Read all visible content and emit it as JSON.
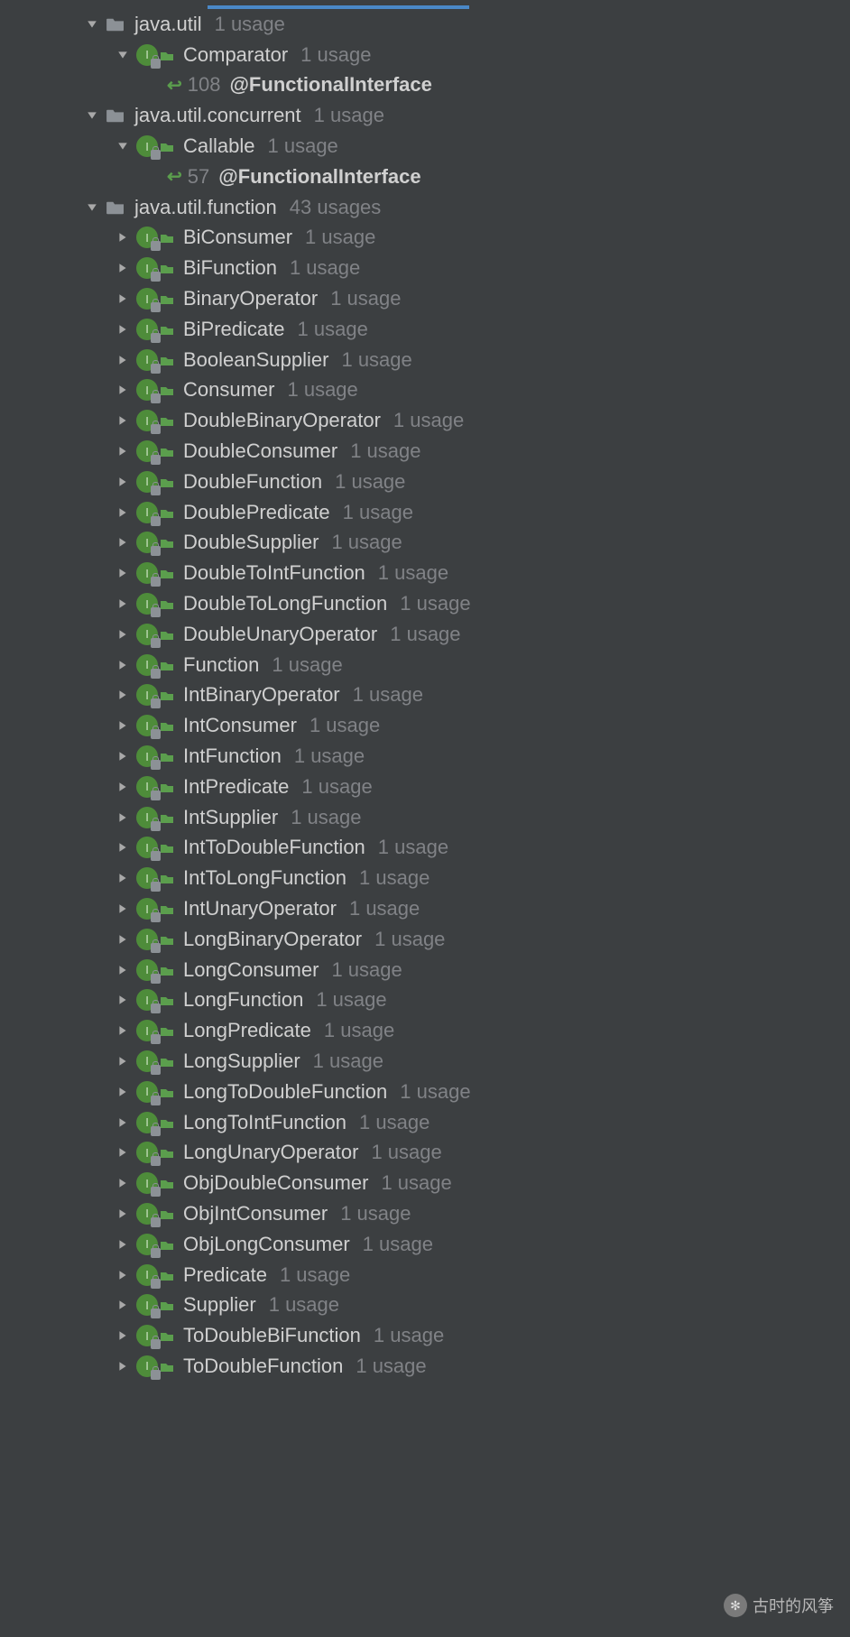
{
  "annot": "@FunctionalInterface",
  "watermark": "古时的风筝",
  "packages": [
    {
      "name": "java.util",
      "usage": "1 usage",
      "expanded": true,
      "classes": [
        {
          "name": "Comparator",
          "usage": "1 usage",
          "expanded": true,
          "annotLine": "108"
        }
      ]
    },
    {
      "name": "java.util.concurrent",
      "usage": "1 usage",
      "expanded": true,
      "classes": [
        {
          "name": "Callable",
          "usage": "1 usage",
          "expanded": true,
          "annotLine": "57"
        }
      ]
    },
    {
      "name": "java.util.function",
      "usage": "43 usages",
      "expanded": true,
      "classes": [
        {
          "name": "BiConsumer",
          "usage": "1 usage"
        },
        {
          "name": "BiFunction",
          "usage": "1 usage"
        },
        {
          "name": "BinaryOperator",
          "usage": "1 usage"
        },
        {
          "name": "BiPredicate",
          "usage": "1 usage"
        },
        {
          "name": "BooleanSupplier",
          "usage": "1 usage"
        },
        {
          "name": "Consumer",
          "usage": "1 usage"
        },
        {
          "name": "DoubleBinaryOperator",
          "usage": "1 usage"
        },
        {
          "name": "DoubleConsumer",
          "usage": "1 usage"
        },
        {
          "name": "DoubleFunction",
          "usage": "1 usage"
        },
        {
          "name": "DoublePredicate",
          "usage": "1 usage"
        },
        {
          "name": "DoubleSupplier",
          "usage": "1 usage"
        },
        {
          "name": "DoubleToIntFunction",
          "usage": "1 usage"
        },
        {
          "name": "DoubleToLongFunction",
          "usage": "1 usage"
        },
        {
          "name": "DoubleUnaryOperator",
          "usage": "1 usage"
        },
        {
          "name": "Function",
          "usage": "1 usage"
        },
        {
          "name": "IntBinaryOperator",
          "usage": "1 usage"
        },
        {
          "name": "IntConsumer",
          "usage": "1 usage"
        },
        {
          "name": "IntFunction",
          "usage": "1 usage"
        },
        {
          "name": "IntPredicate",
          "usage": "1 usage"
        },
        {
          "name": "IntSupplier",
          "usage": "1 usage"
        },
        {
          "name": "IntToDoubleFunction",
          "usage": "1 usage"
        },
        {
          "name": "IntToLongFunction",
          "usage": "1 usage"
        },
        {
          "name": "IntUnaryOperator",
          "usage": "1 usage"
        },
        {
          "name": "LongBinaryOperator",
          "usage": "1 usage"
        },
        {
          "name": "LongConsumer",
          "usage": "1 usage"
        },
        {
          "name": "LongFunction",
          "usage": "1 usage"
        },
        {
          "name": "LongPredicate",
          "usage": "1 usage"
        },
        {
          "name": "LongSupplier",
          "usage": "1 usage"
        },
        {
          "name": "LongToDoubleFunction",
          "usage": "1 usage"
        },
        {
          "name": "LongToIntFunction",
          "usage": "1 usage"
        },
        {
          "name": "LongUnaryOperator",
          "usage": "1 usage"
        },
        {
          "name": "ObjDoubleConsumer",
          "usage": "1 usage"
        },
        {
          "name": "ObjIntConsumer",
          "usage": "1 usage"
        },
        {
          "name": "ObjLongConsumer",
          "usage": "1 usage"
        },
        {
          "name": "Predicate",
          "usage": "1 usage"
        },
        {
          "name": "Supplier",
          "usage": "1 usage"
        },
        {
          "name": "ToDoubleBiFunction",
          "usage": "1 usage"
        },
        {
          "name": "ToDoubleFunction",
          "usage": "1 usage"
        }
      ]
    }
  ]
}
